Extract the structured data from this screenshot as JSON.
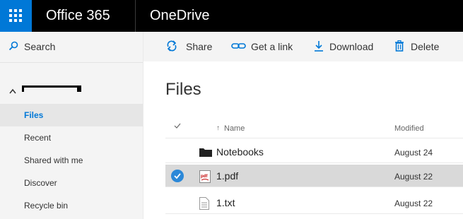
{
  "header": {
    "app_title": "Office 365",
    "product_title": "OneDrive",
    "accent": "#0078d7"
  },
  "sidebar": {
    "search_label": "Search",
    "items": [
      {
        "label": "Files",
        "active": true
      },
      {
        "label": "Recent",
        "active": false
      },
      {
        "label": "Shared with me",
        "active": false
      },
      {
        "label": "Discover",
        "active": false
      },
      {
        "label": "Recycle bin",
        "active": false
      }
    ]
  },
  "toolbar": {
    "share_label": "Share",
    "link_label": "Get a link",
    "download_label": "Download",
    "delete_label": "Delete"
  },
  "main": {
    "title": "Files",
    "columns": {
      "name": "Name",
      "modified": "Modified"
    },
    "rows": [
      {
        "name": "Notebooks",
        "modified": "August 24",
        "type": "folder-icon",
        "selected": false
      },
      {
        "name": "1.pdf",
        "modified": "August 22",
        "type": "pdf-icon",
        "selected": true
      },
      {
        "name": "1.txt",
        "modified": "August 22",
        "type": "text-file-icon",
        "selected": false
      }
    ]
  }
}
